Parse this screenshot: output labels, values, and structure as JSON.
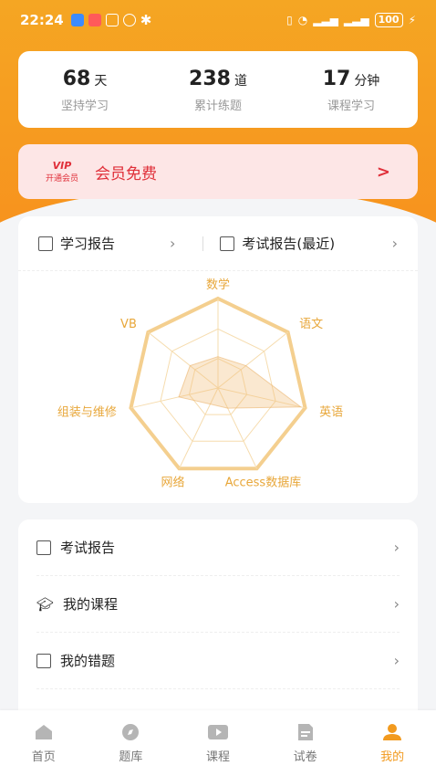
{
  "status_bar": {
    "time": "22:24",
    "battery": "100"
  },
  "stats": [
    {
      "num": "68",
      "unit": "天",
      "label": "坚持学习"
    },
    {
      "num": "238",
      "unit": "道",
      "label": "累计练题"
    },
    {
      "num": "17",
      "unit": "分钟",
      "label": "课程学习"
    }
  ],
  "vip": {
    "badge": "VIP",
    "badge_sub": "开通会员",
    "title": "会员免费",
    "chevron": ">"
  },
  "report": {
    "study_report": "学习报告",
    "exam_report_recent": "考试报告(最近)",
    "radar_labels": [
      "数学",
      "语文",
      "英语",
      "Access数据库",
      "网络",
      "组装与维修",
      "VB"
    ],
    "radar_values": [
      0.35,
      0.4,
      0.95,
      0.25,
      0.2,
      0.45,
      0.4
    ]
  },
  "menu": [
    {
      "label": "考试报告",
      "icon": "report-icon"
    },
    {
      "label": "我的课程",
      "icon": "graduation-cap-icon"
    },
    {
      "label": "我的错题",
      "icon": "wrong-question-icon"
    }
  ],
  "tabs": [
    {
      "label": "首页",
      "icon": "home-icon"
    },
    {
      "label": "题库",
      "icon": "compass-icon"
    },
    {
      "label": "课程",
      "icon": "play-icon"
    },
    {
      "label": "试卷",
      "icon": "paper-icon"
    },
    {
      "label": "我的",
      "icon": "person-icon",
      "active": true
    }
  ],
  "colors": {
    "accent": "#f29a1e",
    "vip_red": "#e0303a",
    "radar": "#e8a73a"
  }
}
